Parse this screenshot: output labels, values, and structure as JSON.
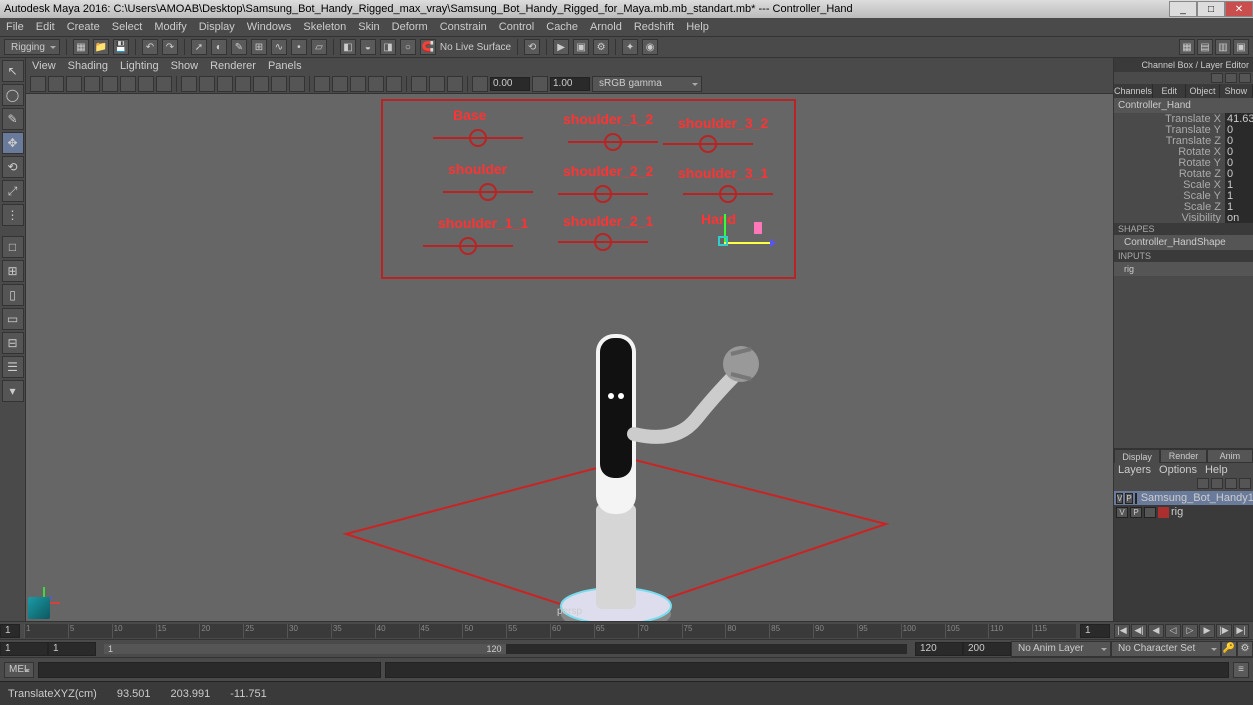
{
  "title": "Autodesk Maya 2016: C:\\Users\\AMOAB\\Desktop\\Samsung_Bot_Handy_Rigged_max_vray\\Samsung_Bot_Handy_Rigged_for_Maya.mb.mb_standart.mb*  ---  Controller_Hand",
  "menus": [
    "File",
    "Edit",
    "Create",
    "Select",
    "Modify",
    "Display",
    "Windows",
    "Skeleton",
    "Skin",
    "Deform",
    "Constrain",
    "Control",
    "Cache",
    "Arnold",
    "Redshift",
    "Help"
  ],
  "workspace_dd": "Rigging",
  "shelf": {
    "nolivesurface": "No Live Surface"
  },
  "panel_menus": [
    "View",
    "Shading",
    "Lighting",
    "Show",
    "Renderer",
    "Panels"
  ],
  "vt_exposure": "0.00",
  "vt_gamma": "1.00",
  "vt_colorspace": "sRGB gamma",
  "camera": "persp",
  "channelbox": {
    "title": "Channel Box / Layer Editor",
    "tabs": [
      "Channels",
      "Edit",
      "Object",
      "Show"
    ],
    "selected": "Controller_Hand",
    "attrs": [
      {
        "lbl": "Translate X",
        "val": "41.632"
      },
      {
        "lbl": "Translate Y",
        "val": "0"
      },
      {
        "lbl": "Translate Z",
        "val": "0"
      },
      {
        "lbl": "Rotate X",
        "val": "0"
      },
      {
        "lbl": "Rotate Y",
        "val": "0"
      },
      {
        "lbl": "Rotate Z",
        "val": "0"
      },
      {
        "lbl": "Scale X",
        "val": "1"
      },
      {
        "lbl": "Scale Y",
        "val": "1"
      },
      {
        "lbl": "Scale Z",
        "val": "1"
      },
      {
        "lbl": "Visibility",
        "val": "on"
      }
    ],
    "shapes_h": "SHAPES",
    "shape": "Controller_HandShape",
    "inputs_h": "INPUTS",
    "input": "rig"
  },
  "layers": {
    "tabs": [
      "Display",
      "Render",
      "Anim"
    ],
    "menu": [
      "Layers",
      "Options",
      "Help"
    ],
    "rows": [
      {
        "v": "V",
        "p": "P",
        "color": "#4a6aaa",
        "name": "Samsung_Bot_Handy1",
        "sel": true
      },
      {
        "v": "V",
        "p": "P",
        "color": "#aa3030",
        "name": "rig",
        "sel": false
      }
    ]
  },
  "timeline": {
    "ticks": [
      "1",
      "5",
      "10",
      "15",
      "20",
      "25",
      "30",
      "35",
      "40",
      "45",
      "50",
      "55",
      "60",
      "65",
      "70",
      "75",
      "80",
      "85",
      "90",
      "95",
      "100",
      "105",
      "110",
      "115",
      "120"
    ],
    "start_outer": "1",
    "start_inner": "1",
    "end_inner": "120",
    "end_outer": "120",
    "end_range": "200",
    "current": "1",
    "anim_layer": "No Anim Layer",
    "char_set": "No Character Set"
  },
  "cmd_label": "MEL",
  "status": {
    "label": "TranslateXYZ(cm)",
    "x": "93.501",
    "y": "203.991",
    "z": "-11.751"
  },
  "controls": {
    "c1": "Base",
    "c2": "shoulder_1_2",
    "c3": "shoulder_3_2",
    "c4": "shoulder",
    "c5": "shoulder_2_2",
    "c6": "shoulder_3_1",
    "c7": "shoulder_1_1",
    "c8": "shoulder_2_1",
    "c9": "Hand"
  }
}
